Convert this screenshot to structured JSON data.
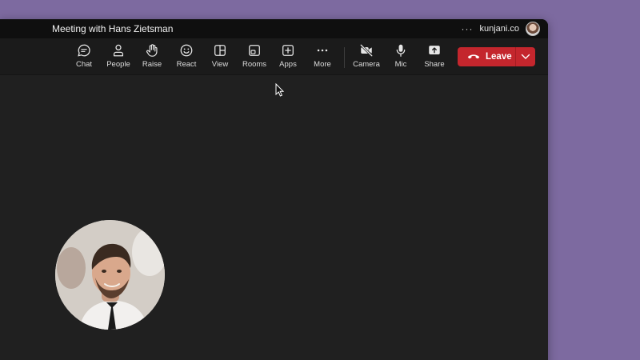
{
  "window": {
    "title": "Meeting with Hans Zietsman",
    "more_dots": "···",
    "account": "kunjani.co"
  },
  "toolbar": {
    "chat": "Chat",
    "people": "People",
    "raise": "Raise",
    "react": "React",
    "view": "View",
    "rooms": "Rooms",
    "apps": "Apps",
    "more": "More",
    "camera": "Camera",
    "mic": "Mic",
    "share": "Share",
    "leave": "Leave"
  },
  "colors": {
    "background": "#7d6aa0",
    "leave_button": "#c4262d",
    "window": "#1f1f1f"
  }
}
